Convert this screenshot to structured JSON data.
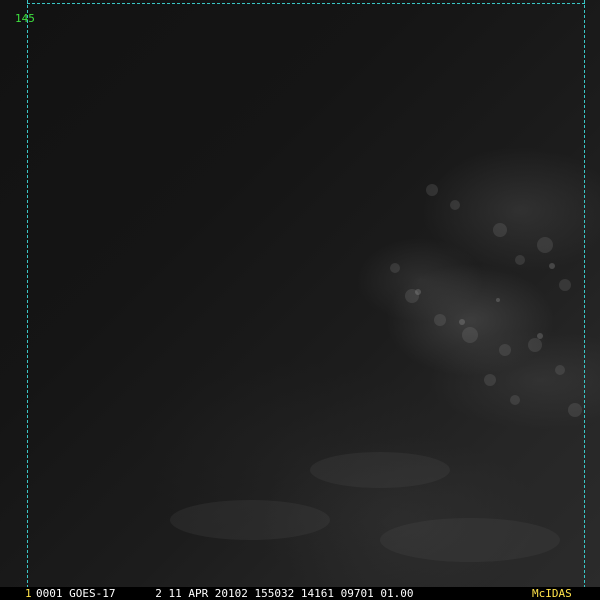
{
  "overlay": {
    "lat_label": "145"
  },
  "status_bar": {
    "frame_number": "1",
    "text": "0001 GOES-17      2 11 APR 20102 155032 14161 09701 01.00",
    "brand": "McIDAS"
  },
  "colors": {
    "grid_line": "#39c6c6",
    "lat_label": "#3ee03e",
    "frame_number": "#ffe24a",
    "brand": "#ffe24a",
    "status_text": "#ffffff"
  }
}
